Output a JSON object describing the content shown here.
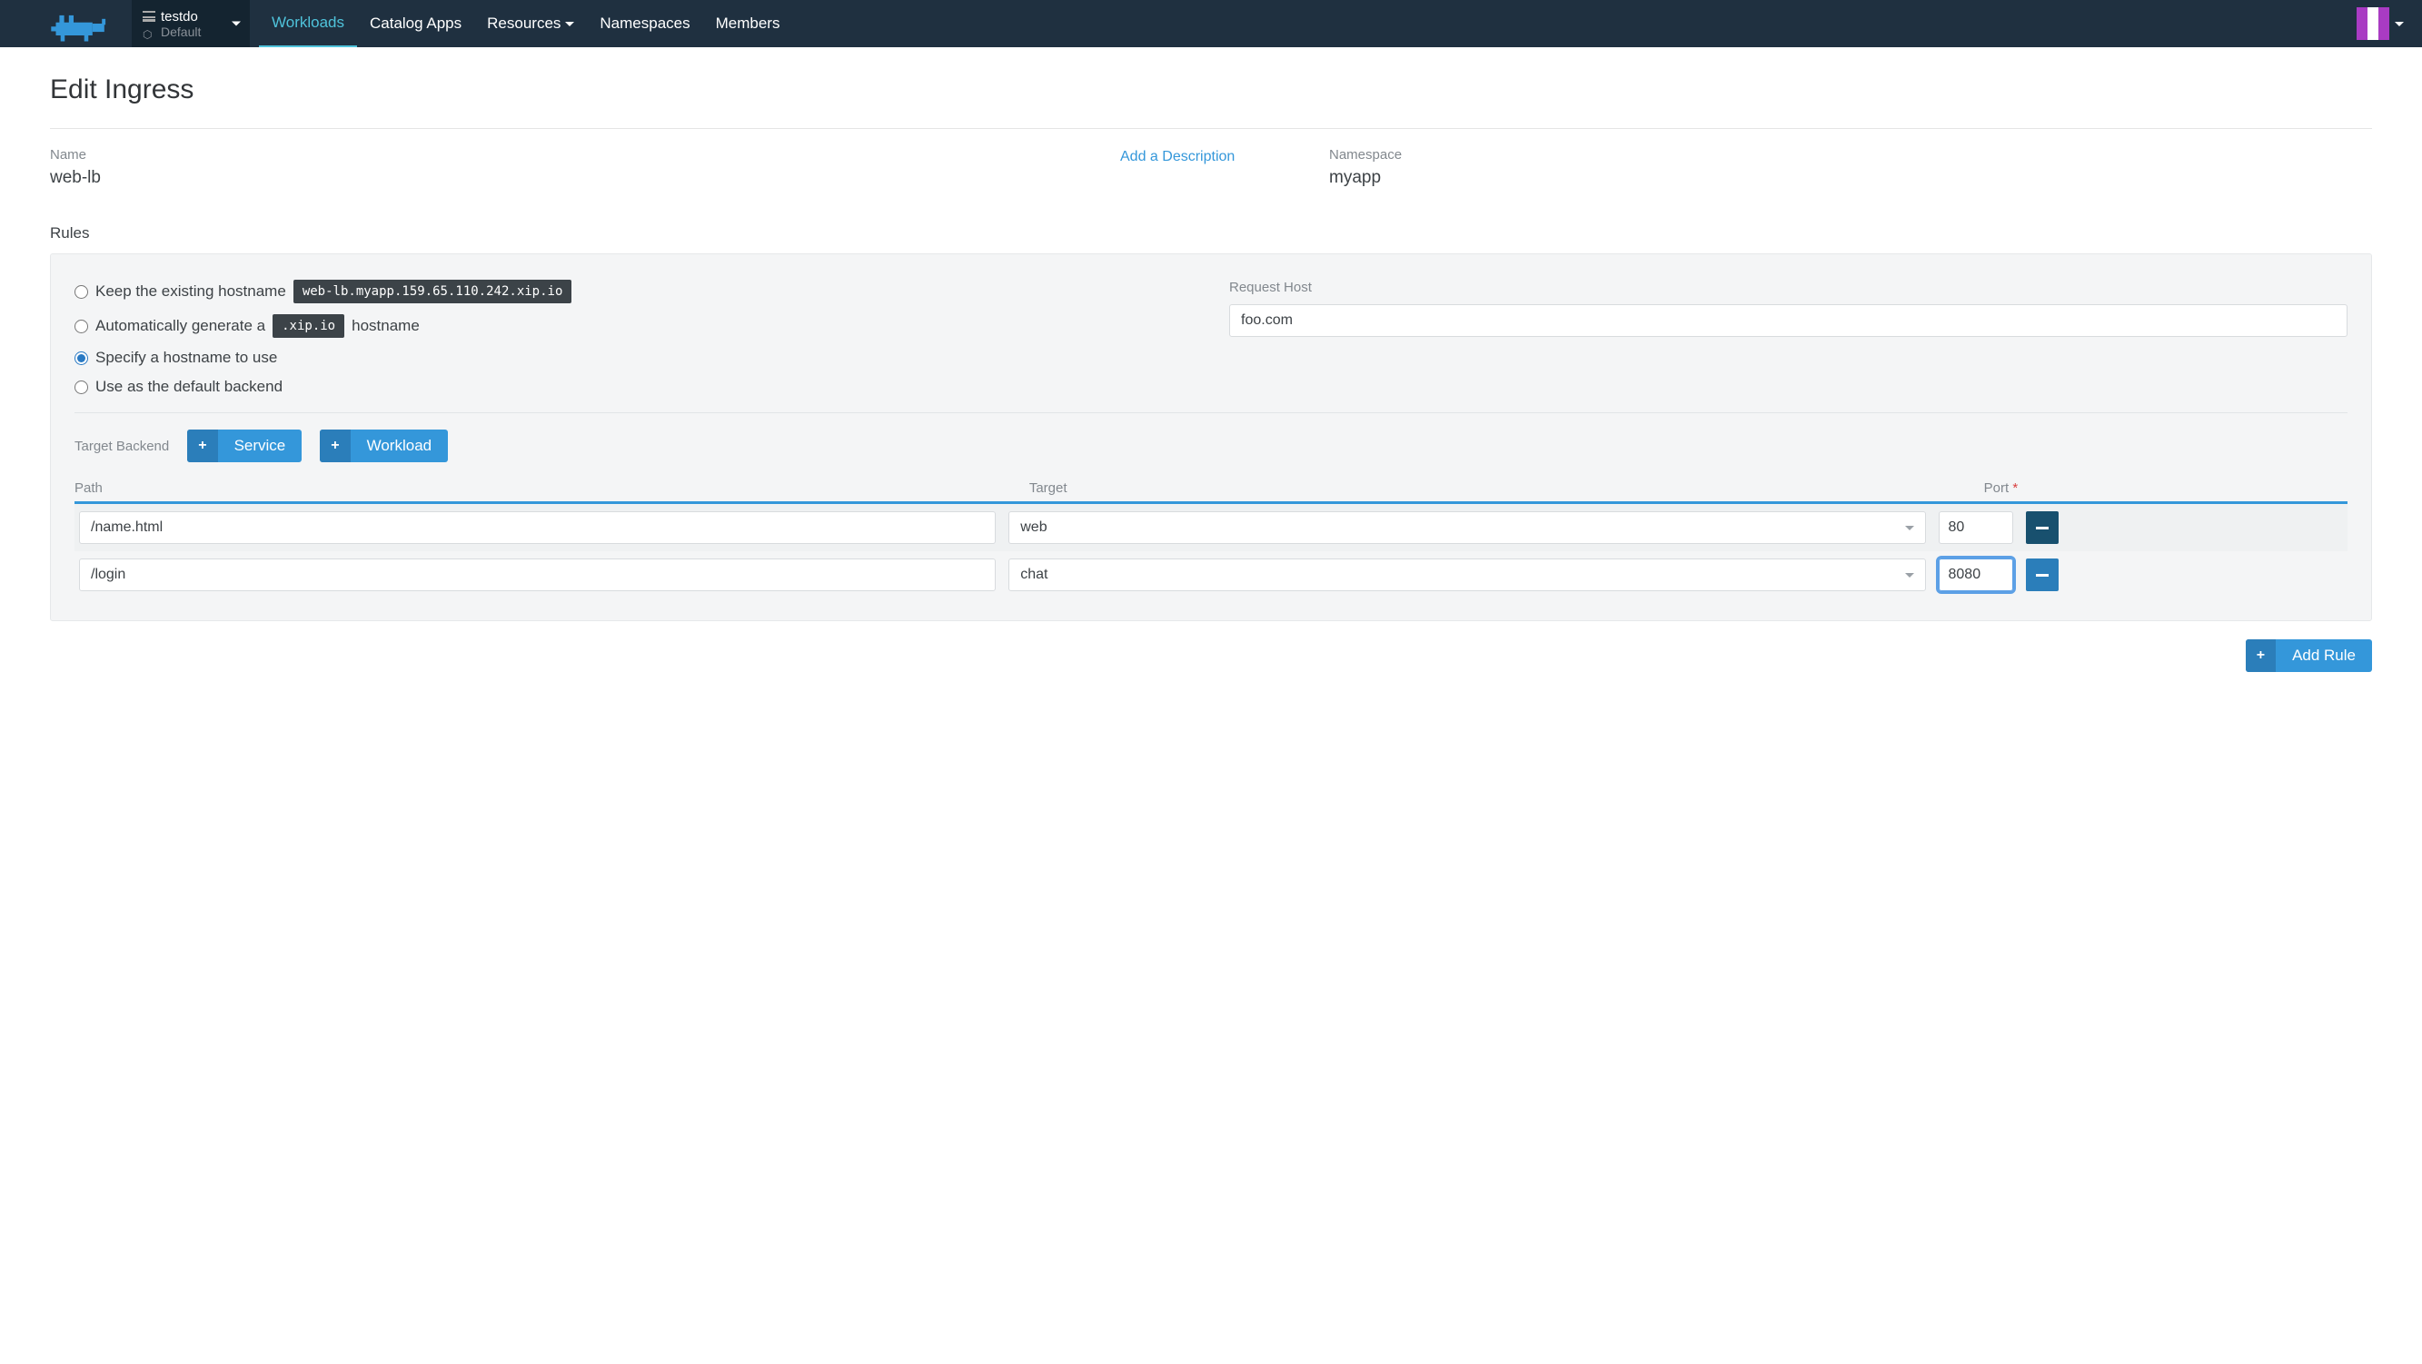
{
  "header": {
    "project": "testdo",
    "subproject": "Default",
    "nav": {
      "workloads": "Workloads",
      "catalog": "Catalog Apps",
      "resources": "Resources",
      "namespaces": "Namespaces",
      "members": "Members"
    }
  },
  "page": {
    "title": "Edit Ingress",
    "name_label": "Name",
    "name_value": "web-lb",
    "add_description": "Add a Description",
    "namespace_label": "Namespace",
    "namespace_value": "myapp",
    "rules_label": "Rules"
  },
  "rule": {
    "options": {
      "keep": "Keep the existing hostname",
      "keep_host": "web-lb.myapp.159.65.110.242.xip.io",
      "auto_pre": "Automatically generate a",
      "auto_code": ".xip.io",
      "auto_post": "hostname",
      "specify": "Specify a hostname to use",
      "default": "Use as the default backend"
    },
    "request_host_label": "Request Host",
    "request_host_value": "foo.com",
    "target_backend_label": "Target Backend",
    "service_btn": "Service",
    "workload_btn": "Workload",
    "columns": {
      "path": "Path",
      "target": "Target",
      "port": "Port"
    },
    "rows": [
      {
        "path": "/name.html",
        "target": "web",
        "port": "80"
      },
      {
        "path": "/login",
        "target": "chat",
        "port": "8080"
      }
    ]
  },
  "actions": {
    "add_rule": "Add Rule"
  }
}
